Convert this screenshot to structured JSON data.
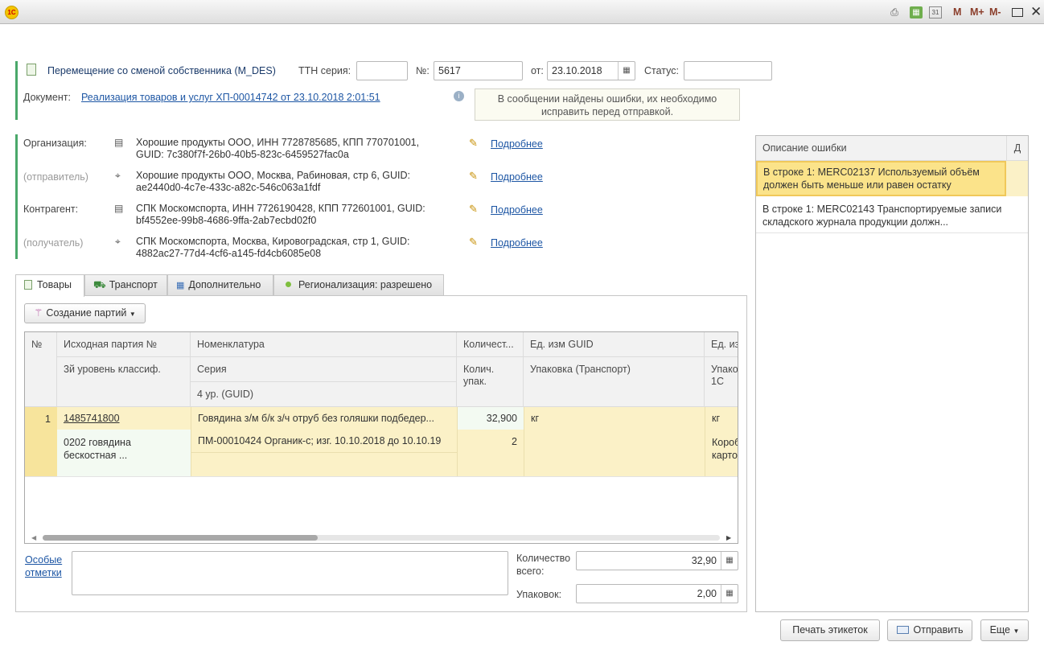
{
  "window": {
    "logo": "1С",
    "toolbar_icons": [
      "print-icon",
      "calculator-icon",
      "calendar-icon"
    ],
    "memory_buttons": [
      "M",
      "M+",
      "M-"
    ],
    "controls": [
      "maximize-icon",
      "close-icon"
    ]
  },
  "header": {
    "doc_type": "Перемещение со сменой собственника (M_DES)",
    "ttn_series_label": "ТТН серия:",
    "ttn_series_value": "",
    "number_label": "№:",
    "number_value": "5617",
    "date_label": "от:",
    "date_value": "23.10.2018",
    "status_label": "Статус:",
    "status_value": "",
    "document_label": "Документ:",
    "document_link": "Реализация товаров и услуг ХП-00014742 от 23.10.2018 2:01:51",
    "error_notice": "В сообщении найдены ошибки, их необходимо исправить перед отправкой."
  },
  "parties": [
    {
      "label": "Организация:",
      "label_style": "normal",
      "icon": "building-icon",
      "text": "Хорошие продукты ООО,  ИНН 7728785685, КПП 770701001, GUID: 7c380f7f-26b0-40b5-823c-6459527fac0a",
      "more": "Подробнее"
    },
    {
      "label": "(отправитель)",
      "label_style": "grey",
      "icon": "map-pin-icon",
      "text": "Хорошие продукты ООО, Москва, Рабиновая, стр 6, GUID: ae2440d0-4c7e-433c-a82c-546c063a1fdf",
      "more": "Подробнее"
    },
    {
      "label": "Контрагент:",
      "label_style": "normal",
      "icon": "building-icon",
      "text": "СПК Москомспорта,  ИНН 7726190428, КПП 772601001, GUID: bf4552ee-99b8-4686-9ffa-2ab7ecbd02f0",
      "more": "Подробнее"
    },
    {
      "label": "(получатель)",
      "label_style": "grey",
      "icon": "map-pin-icon",
      "text": "СПК Москомспорта, Москва, Кировоградская, стр 1, GUID: 4882ac27-77d4-4cf6-a145-fd4cb6085e08",
      "more": "Подробнее"
    }
  ],
  "tabs": [
    {
      "label": "Товары",
      "icon": "document-icon"
    },
    {
      "label": "Транспорт",
      "icon": "truck-icon"
    },
    {
      "label": "Дополнительно",
      "icon": "grid-icon"
    },
    {
      "label": "Регионализация: разрешено",
      "icon": "green-dot-icon"
    }
  ],
  "create_batches_button": "Создание партий",
  "table": {
    "headers": {
      "num": "№",
      "source_batch": "Исходная партия №",
      "classifier": "3й уровень классиф.",
      "nomenclature": "Номенклатура",
      "series": "Серия",
      "level4": "4 ур. (GUID)",
      "quantity": "Количест...",
      "pack_qty": "Колич. упак.",
      "unit_guid": "Ед. изм GUID",
      "packaging": "Упаковка (Транспорт)",
      "unit_1c": "Ед. из",
      "pack_1c": "Упако 1С"
    },
    "rows": [
      {
        "num": "1",
        "source_batch": "1485741800",
        "nomenclature": "Говядина з/м б/к з/ч отруб без голяшки подбедер...",
        "quantity": "32,900",
        "unit_guid": "кг",
        "unit_1c": "кг",
        "classifier": "0202 говядина бескостная ...",
        "series": "ПМ-00010424 Органик-с; изг. 10.10.2018 до 10.10.19",
        "pack_qty": "2",
        "packaging": "",
        "pack_1c": "Короб карто"
      }
    ]
  },
  "footer": {
    "special_notes_label": "Особые отметки",
    "special_notes_value": "",
    "total_qty_label": "Количество всего:",
    "total_qty_value": "32,90",
    "packages_label": "Упаковок:",
    "packages_value": "2,00"
  },
  "errors": {
    "header": "Описание ошибки",
    "header_col2": "Д",
    "items": [
      "В строке 1: MERC02137 Используемый объём должен быть меньше или равен остатку",
      "В строке 1: MERC02143 Транспортируемые записи складского журнала продукции должн..."
    ]
  },
  "actions": {
    "print_labels": "Печать этикеток",
    "send": "Отправить",
    "more": "Еще"
  },
  "colors": {
    "link": "#1d56a4",
    "accent_bar": "#4aa86a",
    "row_highlight": "#fbf1c7",
    "selected_error": "#fbe38a"
  }
}
